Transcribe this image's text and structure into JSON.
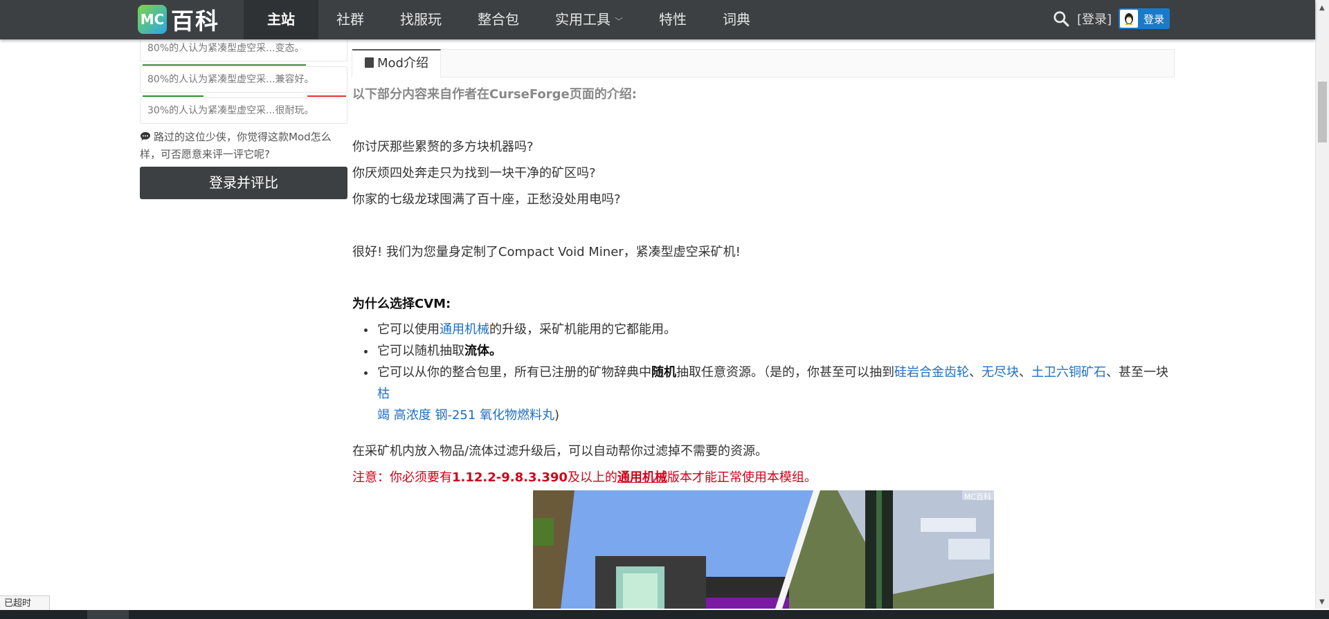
{
  "nav": {
    "logo_mc": "MC",
    "logo_text": "百科",
    "items": [
      "主站",
      "社群",
      "找服玩",
      "整合包",
      "实用工具",
      "特性",
      "词典"
    ],
    "login_link": "[登录]",
    "qq_login": "登录"
  },
  "sidebar": {
    "ratings": [
      {
        "text": "80%的人认为紧凑型虚空采...变态。",
        "percent": 80
      },
      {
        "text": "80%的人认为紧凑型虚空采...兼容好。",
        "percent": 80
      },
      {
        "text": "30%的人认为紧凑型虚空采...很耐玩。",
        "percent": 30
      }
    ],
    "comment_hint": "路过的这位少侠，你觉得这款Mod怎么样，可否愿意来评一评它呢?",
    "rate_button": "登录并评比"
  },
  "tab": {
    "label": "Mod介绍"
  },
  "content": {
    "intro": "以下部分内容来自作者在CurseForge页面的介绍:",
    "q1": "你讨厌那些累赘的多方块机器吗?",
    "q2": "你厌烦四处奔走只为找到一块干净的矿区吗?",
    "q3": "你家的七级龙球囤满了百十座，正愁没处用电吗?",
    "answer": "很好! 我们为您量身定制了Compact Void Miner，紧凑型虚空采矿机!",
    "why": "为什么选择CVM:",
    "b1_pre": "它可以使用",
    "b1_link": "通用机械",
    "b1_post": "的升级，采矿机能用的它都能用。",
    "b2_pre": "它可以随机抽取",
    "b2_bold": "流体。",
    "b3_pre": "它可以从你的整合包里，所有已注册的矿物辞典中",
    "b3_bold": "随机",
    "b3_mid": "抽取任意资源。（是的，你甚至可以抽到",
    "b3_link1": "硅岩合金齿轮",
    "b3_sep1": "、",
    "b3_link2": "无尽块",
    "b3_sep2": "、",
    "b3_link3": "土卫六铜矿石",
    "b3_sep3": "、甚至一块",
    "b3_link4a": "枯",
    "b3_link4b": "竭 高浓度 钢-251 氧化物燃料丸",
    "b3_end": ")",
    "filter": "在采矿机内放入物品/流体过滤升级后，可以自动帮你过滤掉不需要的资源。",
    "note_pre": "注意：你必须要有",
    "note_ver": "1.12.2-9.8.3.390",
    "note_mid": "及以上的",
    "note_link": "通用机械",
    "note_post": "版本才能正常使用本模组。",
    "watermark": "MC百科"
  },
  "status": {
    "tip": "已超时"
  }
}
